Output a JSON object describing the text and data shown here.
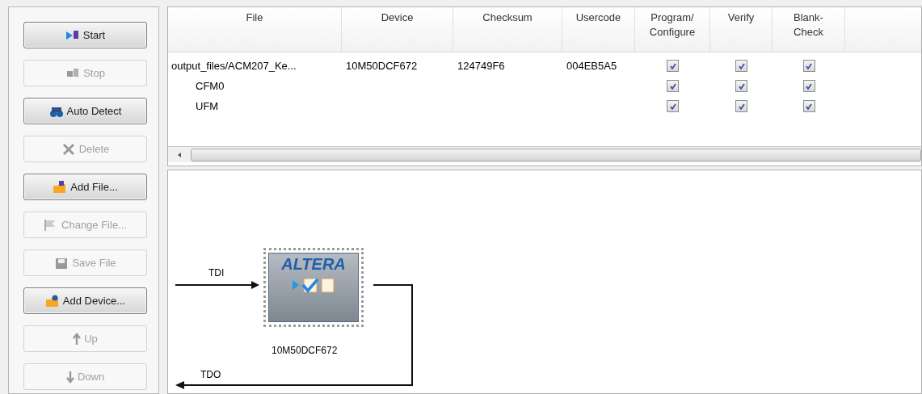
{
  "toolbar": [
    {
      "label": "Start",
      "disabled": false
    },
    {
      "label": "Stop",
      "disabled": true
    },
    {
      "label": "Auto Detect",
      "disabled": false
    },
    {
      "label": "Delete",
      "disabled": true
    },
    {
      "label": "Add File...",
      "disabled": false
    },
    {
      "label": "Change File...",
      "disabled": true
    },
    {
      "label": "Save File",
      "disabled": true
    },
    {
      "label": "Add Device...",
      "disabled": false
    },
    {
      "label": "Up",
      "disabled": true
    },
    {
      "label": "Down",
      "disabled": true
    }
  ],
  "table": {
    "columns": [
      "File",
      "Device",
      "Checksum",
      "Usercode",
      "Program/\nConfigure",
      "Verify",
      "Blank-\nCheck"
    ],
    "rows": [
      {
        "file": "output_files/ACM207_Ke...",
        "device": "10M50DCF672",
        "checksum": "124749F6",
        "usercode": "004EB5A5",
        "program": true,
        "verify": true,
        "blank_check": true,
        "children": [
          {
            "file": "CFM0",
            "program": true,
            "verify": true,
            "blank_check": true
          },
          {
            "file": "UFM",
            "program": true,
            "verify": true,
            "blank_check": true
          }
        ]
      }
    ]
  },
  "diagram": {
    "chip": {
      "logo": "ALTERA",
      "label": "10M50DCF672"
    },
    "input_label": "TDI",
    "output_label": "TDO"
  }
}
